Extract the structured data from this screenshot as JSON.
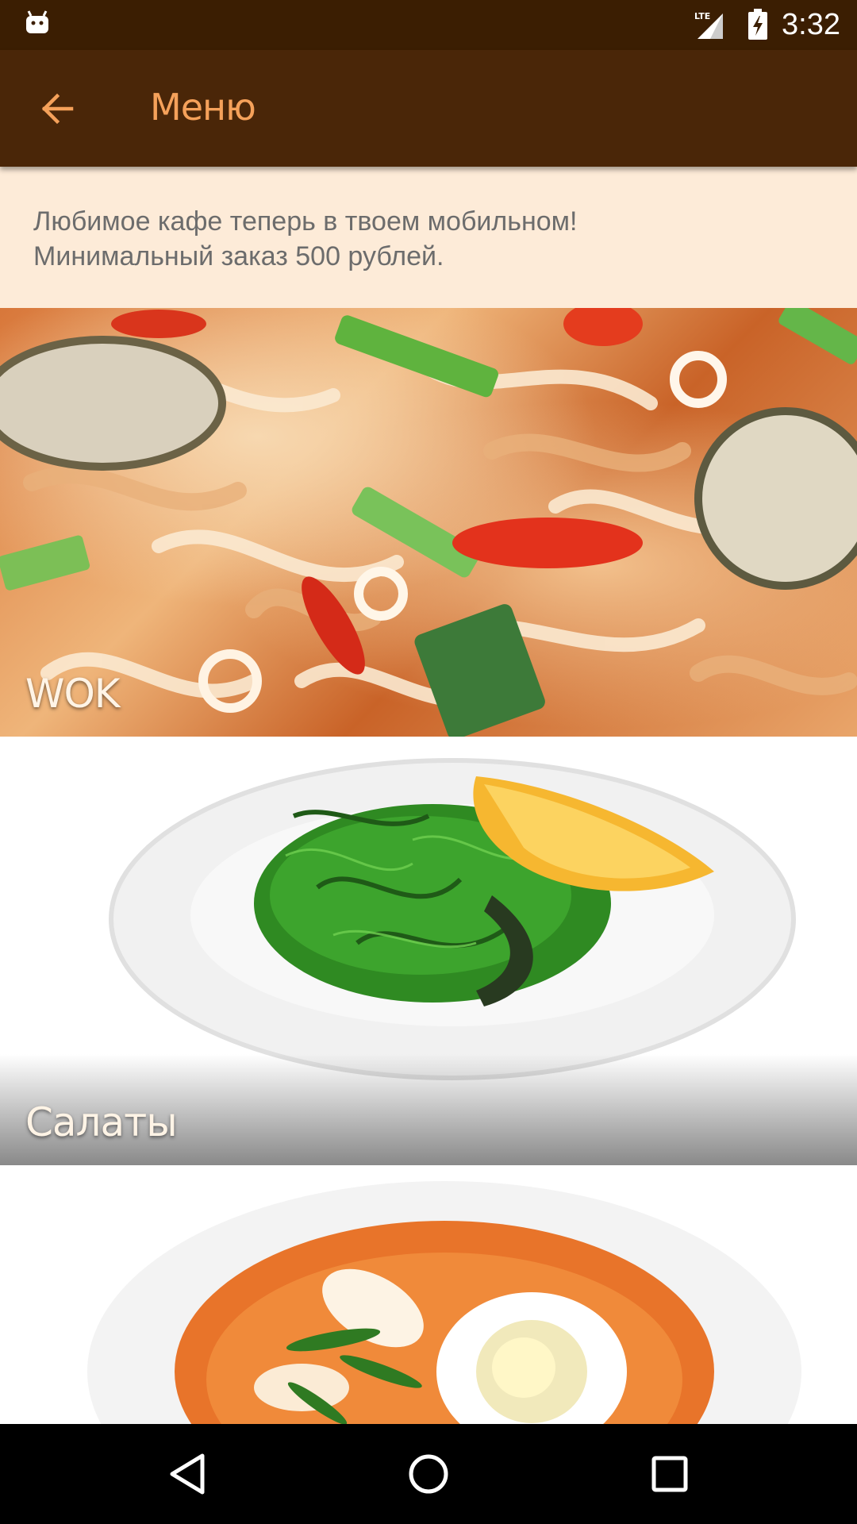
{
  "status_bar": {
    "time": "3:32",
    "network_label": "LTE",
    "icons": [
      "android-notification-icon",
      "lte-signal-icon",
      "battery-charging-icon"
    ]
  },
  "app_bar": {
    "title": "Меню",
    "back_icon": "arrow-left-icon",
    "accent_color": "#f5a15a",
    "background_color": "#4a2608"
  },
  "info_banner": {
    "line1": "Любимое кафе теперь в твоем мобильном!",
    "line2": "Минимальный заказ 500 рублей.",
    "background_color": "#fdebd8"
  },
  "categories": [
    {
      "label": "WOK",
      "image": "wok-noodles-photo"
    },
    {
      "label": "Салаты",
      "image": "seaweed-salad-photo"
    },
    {
      "label": "",
      "image": "soup-photo"
    }
  ],
  "nav_bar": {
    "icons": [
      "nav-back-icon",
      "nav-home-icon",
      "nav-recents-icon"
    ]
  }
}
